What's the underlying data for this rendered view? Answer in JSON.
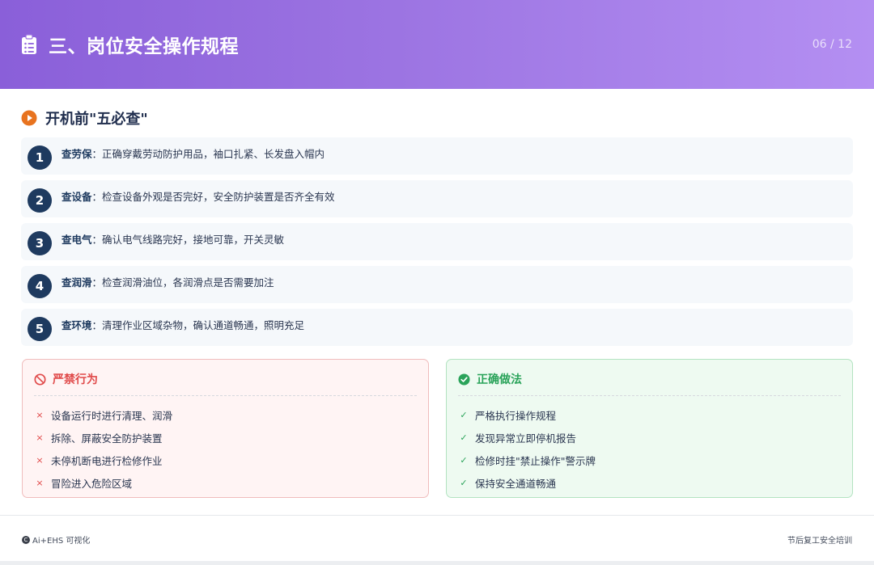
{
  "header": {
    "title": "三、岗位安全操作规程",
    "page_number": "06 / 12",
    "icon": "clipboard-list-icon"
  },
  "section": {
    "title": "开机前\"五必查\"",
    "icon": "play-circle-icon",
    "accent_color": "#e8731f"
  },
  "checklist": [
    {
      "number": "1",
      "label": "查劳保",
      "text": "：正确穿戴劳动防护用品，袖口扎紧、长发盘入帽内"
    },
    {
      "number": "2",
      "label": "查设备",
      "text": "：检查设备外观是否完好，安全防护装置是否齐全有效"
    },
    {
      "number": "3",
      "label": "查电气",
      "text": "：确认电气线路完好，接地可靠，开关灵敏"
    },
    {
      "number": "4",
      "label": "查润滑",
      "text": "：检查润滑油位，各润滑点是否需要加注"
    },
    {
      "number": "5",
      "label": "查环境",
      "text": "：清理作业区域杂物，确认通道畅通，照明充足"
    }
  ],
  "prohibited": {
    "title": "严禁行为",
    "icon": "ban-icon",
    "color": "#e04a4a",
    "mark": "×",
    "items": [
      "设备运行时进行清理、润滑",
      "拆除、屏蔽安全防护装置",
      "未停机断电进行检修作业",
      "冒险进入危险区域"
    ]
  },
  "correct": {
    "title": "正确做法",
    "icon": "check-circle-icon",
    "color": "#2aa35a",
    "mark": "✓",
    "items": [
      "严格执行操作规程",
      "发现异常立即停机报告",
      "检修时挂\"禁止操作\"警示牌",
      "保持安全通道畅通"
    ]
  },
  "footer": {
    "left": "Ai+EHS 可视化",
    "copyright_symbol": "C",
    "right": "节后复工安全培训"
  }
}
